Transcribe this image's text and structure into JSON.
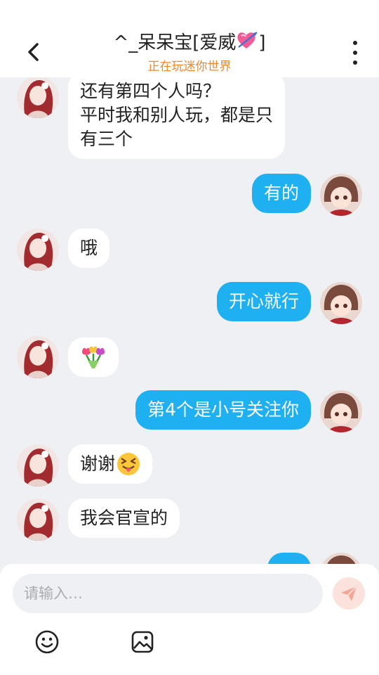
{
  "header": {
    "title_text": "^_呆呆宝[爱威",
    "title_suffix": "]",
    "status": "正在玩迷你世界"
  },
  "messages": [
    {
      "side": "left",
      "lines": [
        "还有第四个人吗？",
        "平时我和别人玩，都是只",
        "有三个"
      ]
    },
    {
      "side": "right",
      "lines": [
        "有的"
      ]
    },
    {
      "side": "left",
      "lines": [
        "哦"
      ]
    },
    {
      "side": "right",
      "lines": [
        "开心就行"
      ]
    },
    {
      "side": "left",
      "lines": [],
      "sticker": "tulip-bouquet-icon"
    },
    {
      "side": "right",
      "lines": [
        "第4个是小号关注你"
      ]
    },
    {
      "side": "left",
      "lines": [
        "谢谢"
      ],
      "emoji": "squinting-tongue-face-icon"
    },
    {
      "side": "left",
      "lines": [
        "我会官宣的"
      ]
    }
  ],
  "composer": {
    "placeholder": "请输入…"
  },
  "icons": {
    "back": "chevron-left-icon",
    "more": "more-vertical-icon",
    "send": "send-icon",
    "emoji": "emoji-icon",
    "image": "image-icon",
    "title_emoji": "heart-with-arrow-icon"
  },
  "colors": {
    "accent_blue": "#1eb0f0",
    "status_orange": "#f0892a",
    "background": "#eef0f3"
  }
}
